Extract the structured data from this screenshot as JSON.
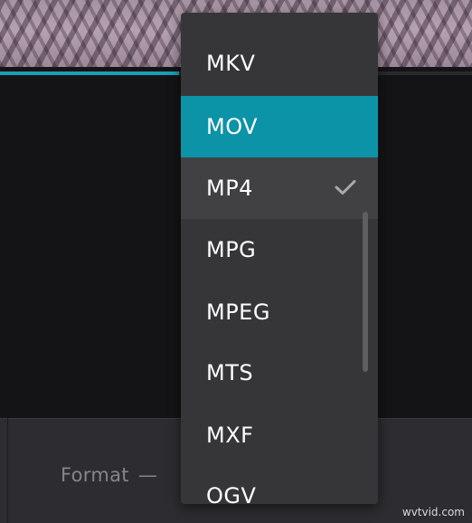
{
  "colors": {
    "accent": "#0c93a8",
    "dropdown_bg": "#363638",
    "selected_bg": "#414144",
    "page_bg": "#141416",
    "panel_bg": "#2d2d31",
    "progress": "#1b9fb3"
  },
  "player": {
    "progress_fraction": 0.38
  },
  "bottom": {
    "format_label": "Format",
    "format_dash": "—"
  },
  "dropdown": {
    "highlighted": "MOV",
    "selected": "MP4",
    "selected_icon": "checkmark-icon",
    "options": [
      {
        "label": "MKV"
      },
      {
        "label": "MOV"
      },
      {
        "label": "MP4"
      },
      {
        "label": "MPG"
      },
      {
        "label": "MPEG"
      },
      {
        "label": "MTS"
      },
      {
        "label": "MXF"
      },
      {
        "label": "OGV"
      }
    ]
  },
  "watermark": "wvtvid.com"
}
